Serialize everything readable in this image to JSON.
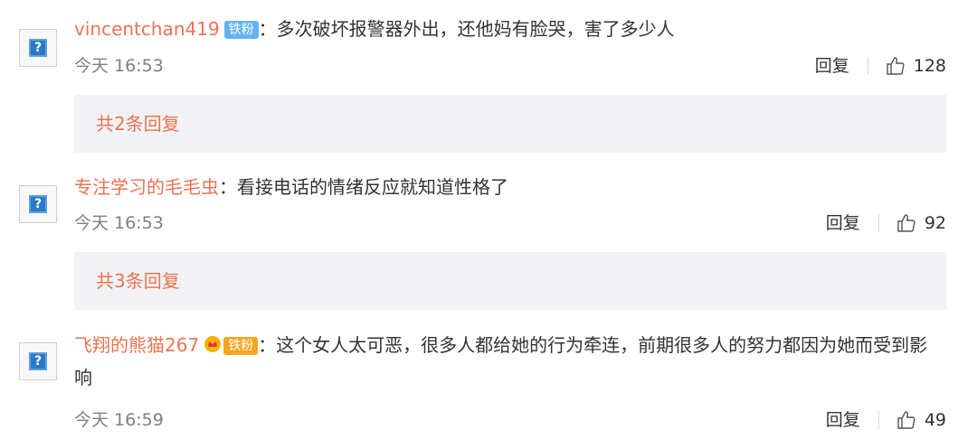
{
  "comments": [
    {
      "user": "vincentchan419",
      "badge": "铁粉",
      "separator": "：",
      "text": "多次破坏报警器外出，还他妈有脸哭，害了多少人",
      "time": "今天 16:53",
      "reply_label": "回复",
      "likes": "128",
      "replies_summary": "共2条回复"
    },
    {
      "user": "专注学习的毛毛虫",
      "separator": "：",
      "text": "看接电话的情绪反应就知道性格了",
      "time": "今天 16:53",
      "reply_label": "回复",
      "likes": "92",
      "replies_summary": "共3条回复"
    },
    {
      "user": "飞翔的熊猫267",
      "badge": "铁粉",
      "separator": "：",
      "text": "这个女人太可恶，很多人都给她的行为牵连，前期很多人的努力都因为她而受到影响",
      "time": "今天 16:59",
      "reply_label": "回复",
      "likes": "49"
    }
  ],
  "icons": {
    "avatar": "broken-image-icon",
    "like": "thumbs-up-icon",
    "crown": "crown-icon"
  },
  "colors": {
    "username": "#eb7350",
    "fan_badge": "#66b3f2",
    "replies_bg": "#f2f2f5",
    "time": "#808080"
  }
}
